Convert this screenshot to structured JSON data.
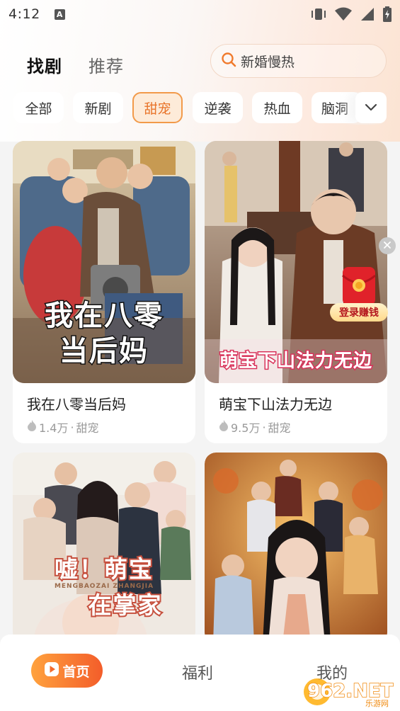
{
  "status": {
    "time": "4:12",
    "notif_icon": "A"
  },
  "tabs": [
    {
      "label": "找剧",
      "active": true
    },
    {
      "label": "推荐",
      "active": false
    }
  ],
  "search": {
    "text": "新婚慢热",
    "icon": "search-icon"
  },
  "chips": [
    {
      "label": "全部",
      "selected": false
    },
    {
      "label": "新剧",
      "selected": false
    },
    {
      "label": "甜宠",
      "selected": true
    },
    {
      "label": "逆袭",
      "selected": false
    },
    {
      "label": "热血",
      "selected": false
    },
    {
      "label": "脑洞",
      "selected": false
    }
  ],
  "cards": [
    {
      "title": "我在八零当后妈",
      "plays": "1.4万",
      "tag": "甜宠",
      "poster_text": [
        "我在八零",
        "当后妈"
      ]
    },
    {
      "title": "萌宝下山法力无边",
      "plays": "9.5万",
      "tag": "甜宠",
      "poster_text": [
        "萌宝下山法力无边"
      ]
    },
    {
      "title": "",
      "plays": "",
      "tag": "",
      "poster_text": [
        "嘘！萌宝",
        "在掌家"
      ],
      "poster_subtext": "MENGBAOZAI ZHANGJIA"
    },
    {
      "title": "",
      "plays": "",
      "tag": "",
      "poster_text": []
    }
  ],
  "promo": {
    "label": "登录赚钱"
  },
  "nav": {
    "home": "首页",
    "welfare": "福利",
    "mine": "我的"
  },
  "watermark": {
    "text": "962.NET",
    "sub": "乐游网"
  },
  "colors": {
    "accent": "#f07a2c",
    "chip_selected_bg": "#fdebd9",
    "promo_red": "#e0222a"
  }
}
